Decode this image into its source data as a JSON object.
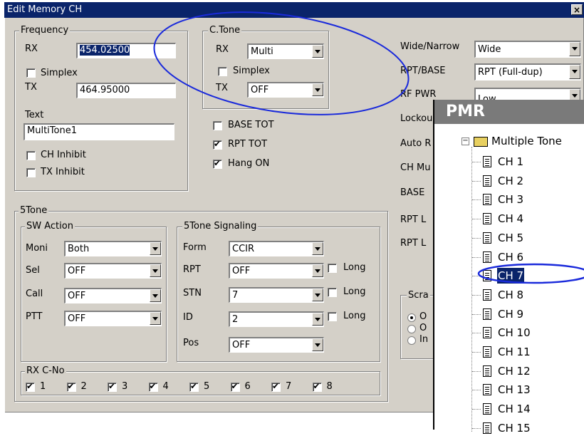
{
  "window": {
    "title": "Edit Memory CH",
    "close": "×"
  },
  "frequency": {
    "group_label": "Frequency",
    "rx_label": "RX",
    "rx_value": "454.02500",
    "simplex_label": "Simplex",
    "tx_label": "TX",
    "tx_value": "464.95000",
    "text_label": "Text",
    "text_value": "MultiTone1",
    "ch_inhibit_label": "CH Inhibit",
    "tx_inhibit_label": "TX Inhibit"
  },
  "ctone": {
    "group_label": "C.Tone",
    "rx_label": "RX",
    "rx_value": "Multi",
    "simplex_label": "Simplex",
    "tx_label": "TX",
    "tx_value": "OFF"
  },
  "options": {
    "base_tot": "BASE TOT",
    "rpt_tot": "RPT TOT",
    "hang_on": "Hang ON"
  },
  "right": {
    "wide_narrow_label": "Wide/Narrow",
    "wide_narrow_value": "Wide",
    "rpt_base_label": "RPT/BASE",
    "rpt_base_value": "RPT (Full-dup)",
    "rf_pwr_label": "RF PWR",
    "rf_pwr_value": "Low",
    "lockout_label": "Lockou",
    "auto_label": "Auto R",
    "ch_mu_label": "CH Mu",
    "base_label": "BASE",
    "rpt_l1_label": "RPT L",
    "rpt_l2_label": "RPT L",
    "scramble_label": "Scra",
    "radio1": "O",
    "radio2": "O",
    "radio3": "In"
  },
  "fivetone": {
    "group_label": "5Tone",
    "sw_action": {
      "group_label": "SW Action",
      "moni_label": "Moni",
      "moni_value": "Both",
      "sel_label": "Sel",
      "sel_value": "OFF",
      "call_label": "Call",
      "call_value": "OFF",
      "ptt_label": "PTT",
      "ptt_value": "OFF"
    },
    "signaling": {
      "group_label": "5Tone Signaling",
      "form_label": "Form",
      "form_value": "CCIR",
      "rpt_label": "RPT",
      "rpt_value": "OFF",
      "stn_label": "STN",
      "stn_value": "7",
      "id_label": "ID",
      "id_value": "2",
      "pos_label": "Pos",
      "pos_value": "OFF",
      "long_label": "Long"
    },
    "rx_cno": {
      "group_label": "RX C-No",
      "items": [
        "1",
        "2",
        "3",
        "4",
        "5",
        "6",
        "7",
        "8"
      ]
    }
  },
  "pmr": {
    "title": "PMR",
    "folder": "Multiple Tone",
    "channels": [
      "CH 1",
      "CH 2",
      "CH 3",
      "CH 4",
      "CH 5",
      "CH 6",
      "CH 7",
      "CH 8",
      "CH 9",
      "CH 10",
      "CH 11",
      "CH 12",
      "CH 13",
      "CH 14",
      "CH 15"
    ],
    "selected": "CH 7"
  },
  "colors": {
    "title_bar": "#0a246a",
    "face": "#d4d0c8",
    "annotation": "#1a2adb"
  }
}
